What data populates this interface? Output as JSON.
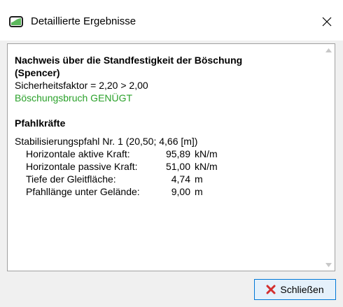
{
  "window": {
    "title": "Detaillierte Ergebnisse"
  },
  "report": {
    "heading_line1": "Nachweis über die Standfestigkeit der Böschung",
    "heading_line2": "(Spencer)",
    "safety_factor": "Sicherheitsfaktor = 2,20 > 2,00",
    "result": "Böschungsbruch GENÜGT",
    "pile_heading": "Pfahlkräfte",
    "pile_name": "Stabilisierungspfahl Nr. 1 (20,50; 4,66 [m])",
    "rows": [
      {
        "label": "Horizontale aktive Kraft:",
        "value": "95,89",
        "unit": "kN/m"
      },
      {
        "label": "Horizontale passive Kraft:",
        "value": "51,00",
        "unit": "kN/m"
      },
      {
        "label": "Tiefe der Gleitfläche:",
        "value": "4,74",
        "unit": "m"
      },
      {
        "label": "Pfahllänge unter Gelände:",
        "value": "9,00",
        "unit": "m"
      }
    ]
  },
  "buttons": {
    "close_label": "Schließen"
  },
  "colors": {
    "ok_green": "#2aa12a",
    "close_x_red": "#d32f2f",
    "icon_green": "#5cb85c"
  },
  "icons": {
    "app": "slope-icon",
    "close": "close-icon",
    "button": "red-x-icon"
  }
}
